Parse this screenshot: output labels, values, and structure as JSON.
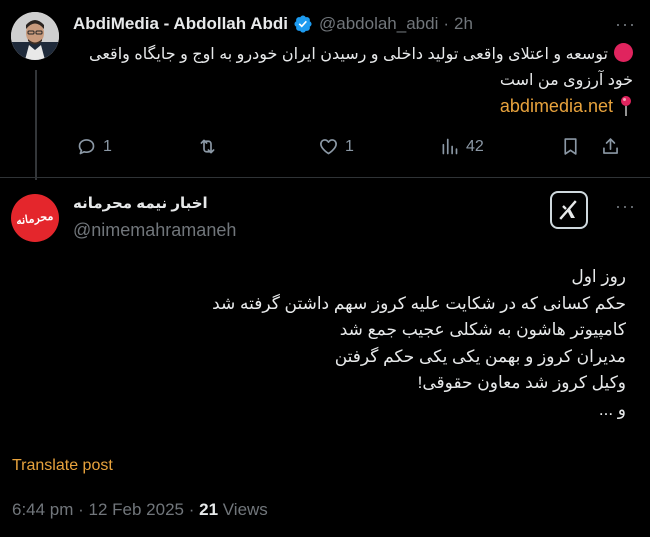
{
  "reply_context": {
    "author_name": "AbdiMedia - Abdollah Abdi",
    "handle": "@abdolah_abdi",
    "separator": "·",
    "time": "2h",
    "text_line1": "توسعه و اعتلای واقعی تولید داخلی و رسیدن ایران خودرو به اوج و جایگاه واقعی",
    "text_line2": "خود آرزوی من است",
    "link": "abdimedia.net",
    "icons": {
      "red_dot": "red-circle-emoji",
      "pin": "round-pushpin-emoji",
      "verified": "verified-badge-icon"
    },
    "actions": {
      "replies": "1",
      "retweets": "",
      "likes": "1",
      "views": "42"
    }
  },
  "main_tweet": {
    "author_name": "اخبار نیمه محرمانه",
    "handle": "@nimemahramaneh",
    "avatar_text": "محرمانه",
    "lines": [
      "روز اول",
      "حکم کسانی که در شکایت علیه کروز سهم داشتن گرفته شد",
      "کامپیوتر  هاشون به شکلی عجیب جمع شد",
      "مدیران کروز و بهمن یکی یکی حکم گرفتن",
      "وکیل کروز شد معاون حقوقی!",
      "و ..."
    ],
    "translate_label": "Translate post",
    "timestamp": "6:44 pm · 12 Feb 2025 · ",
    "views_count": "21",
    "views_label": " Views"
  },
  "colors": {
    "background": "#000000",
    "accent_link": "#e8a33d",
    "verified": "#1d9bf0",
    "muted": "#71767b",
    "avatar_red": "#e4262c"
  }
}
